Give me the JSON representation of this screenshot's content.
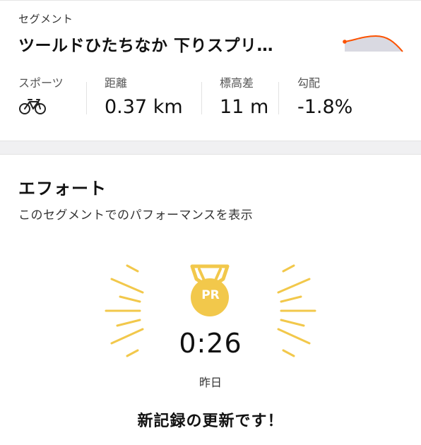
{
  "segment": {
    "section_label": "セグメント",
    "title": "ツールドひたちなか 下りスプリ…",
    "accent_color": "#fc5200",
    "stats": [
      {
        "label": "スポーツ",
        "value": "",
        "icon": "bike-icon"
      },
      {
        "label": "距離",
        "value": "0.37 km"
      },
      {
        "label": "標高差",
        "value": "11 m"
      },
      {
        "label": "勾配",
        "value": "-1.8%"
      }
    ]
  },
  "effort": {
    "title": "エフォート",
    "subtitle": "このセグメントでのパフォーマンスを表示",
    "pr": {
      "badge_text": "PR",
      "badge_color": "#f2c84b",
      "time": "0:26",
      "date": "昨日",
      "message": "新記録の更新です！"
    }
  }
}
